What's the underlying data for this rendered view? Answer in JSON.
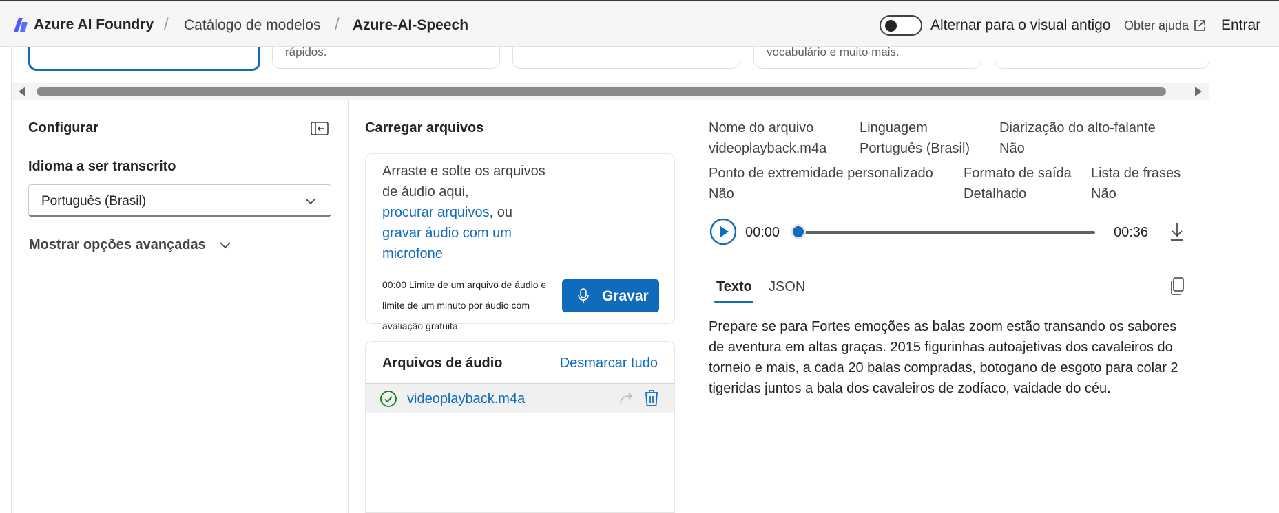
{
  "header": {
    "brand": "Azure AI Foundry",
    "breadcrumbs": [
      "Catálogo de modelos",
      "Azure-AI-Speech"
    ],
    "toggle_label": "Alternar para o visual antigo",
    "help_label": "Obter ajuda",
    "signin_label": "Entrar"
  },
  "cards": [
    {
      "text": ""
    },
    {
      "text": "rápidos."
    },
    {
      "text": ""
    },
    {
      "text": "vocabulário e muito mais."
    },
    {
      "text": ""
    }
  ],
  "configure": {
    "title": "Configurar",
    "language_label": "Idioma a ser transcrito",
    "language_value": "Português (Brasil)",
    "advanced_label": "Mostrar opções avançadas"
  },
  "upload": {
    "title": "Carregar arquivos",
    "drop_text_1": "Arraste e solte os arquivos de áudio aqui,",
    "browse_link": "procurar arquivos",
    "or_text": ", ou",
    "record_link": "gravar áudio com um microfone",
    "limit_text": "00:00 Limite de um arquivo de áudio e limite de um minuto por áudio com avaliação gratuita",
    "record_button": "Gravar"
  },
  "files": {
    "title": "Arquivos de áudio",
    "unselect_all": "Desmarcar tudo",
    "items": [
      {
        "name": "videoplayback.m4a",
        "status": "check-icon"
      }
    ]
  },
  "details": {
    "row1": [
      {
        "label": "Nome do arquivo",
        "value": "videoplayback.m4a"
      },
      {
        "label": "Linguagem",
        "value": "Português (Brasil)"
      },
      {
        "label": "Diarização do alto-falante",
        "value": "Não"
      }
    ],
    "row2": [
      {
        "label": "Ponto de extremidade personalizado",
        "value": "Não"
      },
      {
        "label": "Formato de saída",
        "value": "Detalhado"
      },
      {
        "label": "Lista de frases",
        "value": "Não"
      }
    ]
  },
  "player": {
    "current_time": "00:00",
    "duration": "00:36",
    "progress": 0
  },
  "tabs": [
    {
      "label": "Texto",
      "active": true
    },
    {
      "label": "JSON",
      "active": false
    }
  ],
  "transcript": "Prepare se para Fortes emoções as balas zoom estão transando os sabores de aventura em altas graças. 2015 figurinhas autoajetivas dos cavaleiros do torneio e mais, a cada 20 balas compradas, botogano de esgoto para colar 2 tigeridas juntos a bala dos cavaleiros de zodíaco, vaidade do céu.",
  "colors": {
    "accent": "#0f6cbd",
    "success": "#107c10"
  }
}
